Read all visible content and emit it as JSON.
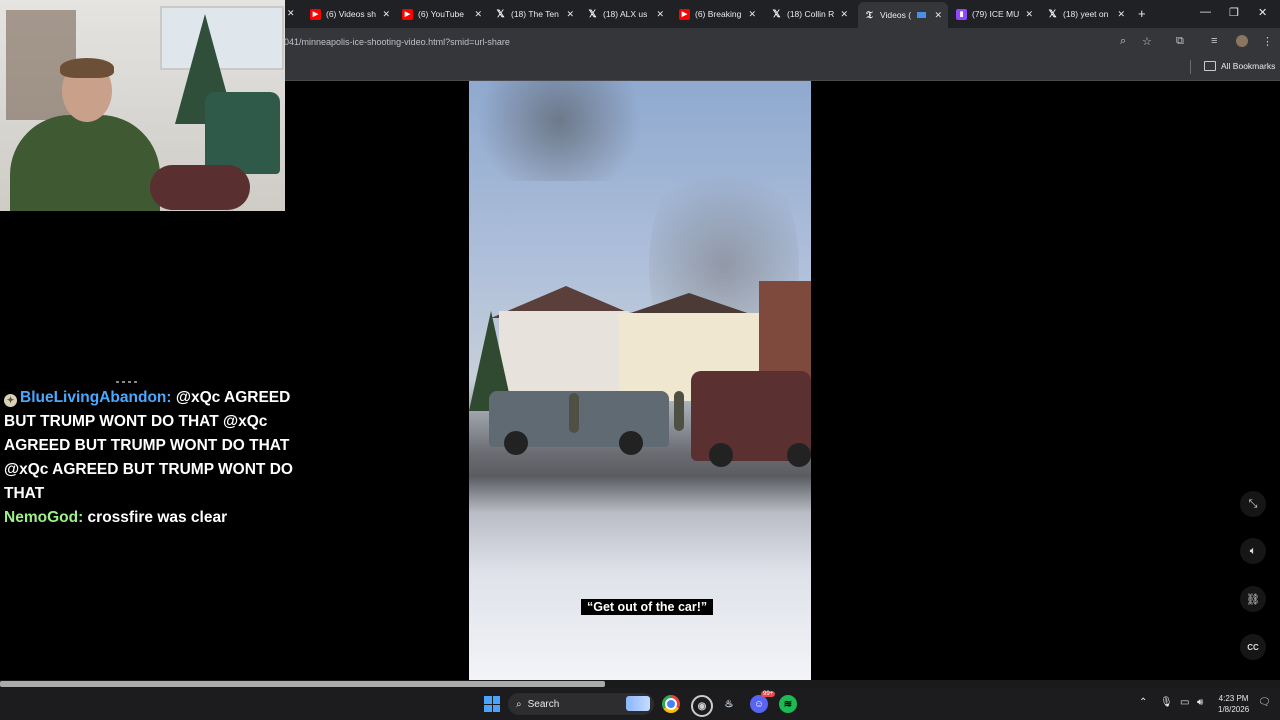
{
  "browser": {
    "tabs": [
      {
        "label": "(6) Videos sh",
        "icon": "youtube-icon"
      },
      {
        "label": "(6) YouTube",
        "icon": "youtube-icon"
      },
      {
        "label": "(18) The Ten",
        "icon": "x-icon"
      },
      {
        "label": "(18) ALX us",
        "icon": "x-icon"
      },
      {
        "label": "(6) Breaking",
        "icon": "youtube-icon"
      },
      {
        "label": "(18) Collin R",
        "icon": "x-icon"
      },
      {
        "label": "Videos (",
        "icon": "nyt-icon",
        "active": true
      },
      {
        "label": "(79) ICE MU",
        "icon": "twitch-icon"
      },
      {
        "label": "(18) yeet on",
        "icon": "x-icon"
      }
    ],
    "close_glyph": "✕",
    "new_tab_glyph": "+",
    "url": "041/minneapolis-ice-shooting-video.html?smid=url-share",
    "bookmarks_label": "All Bookmarks"
  },
  "chat": {
    "messages": [
      {
        "user": "BlueLivingAbandon",
        "text": " @xQc AGREED BUT TRUMP WONT DO THAT @xQc AGREED BUT TRUMP WONT DO THAT @xQc AGREED BUT TRUMP WONT DO THAT",
        "color": "#4aa9ff"
      },
      {
        "user": "NemoGod",
        "text": " crossfire was clear",
        "color": "#9ef08a"
      }
    ],
    "separator": ":"
  },
  "video": {
    "caption": "“Get out of the car!”"
  },
  "taskbar": {
    "search_label": "Search",
    "notification_count": "99+",
    "time": "4:23 PM",
    "date": "1/8/2026"
  },
  "colors": {
    "chrome_bg": "#202124",
    "toolbar_bg": "#35363a",
    "taskbar_bg": "#1c1c1e",
    "accent_blue": "#4aa3ff"
  }
}
